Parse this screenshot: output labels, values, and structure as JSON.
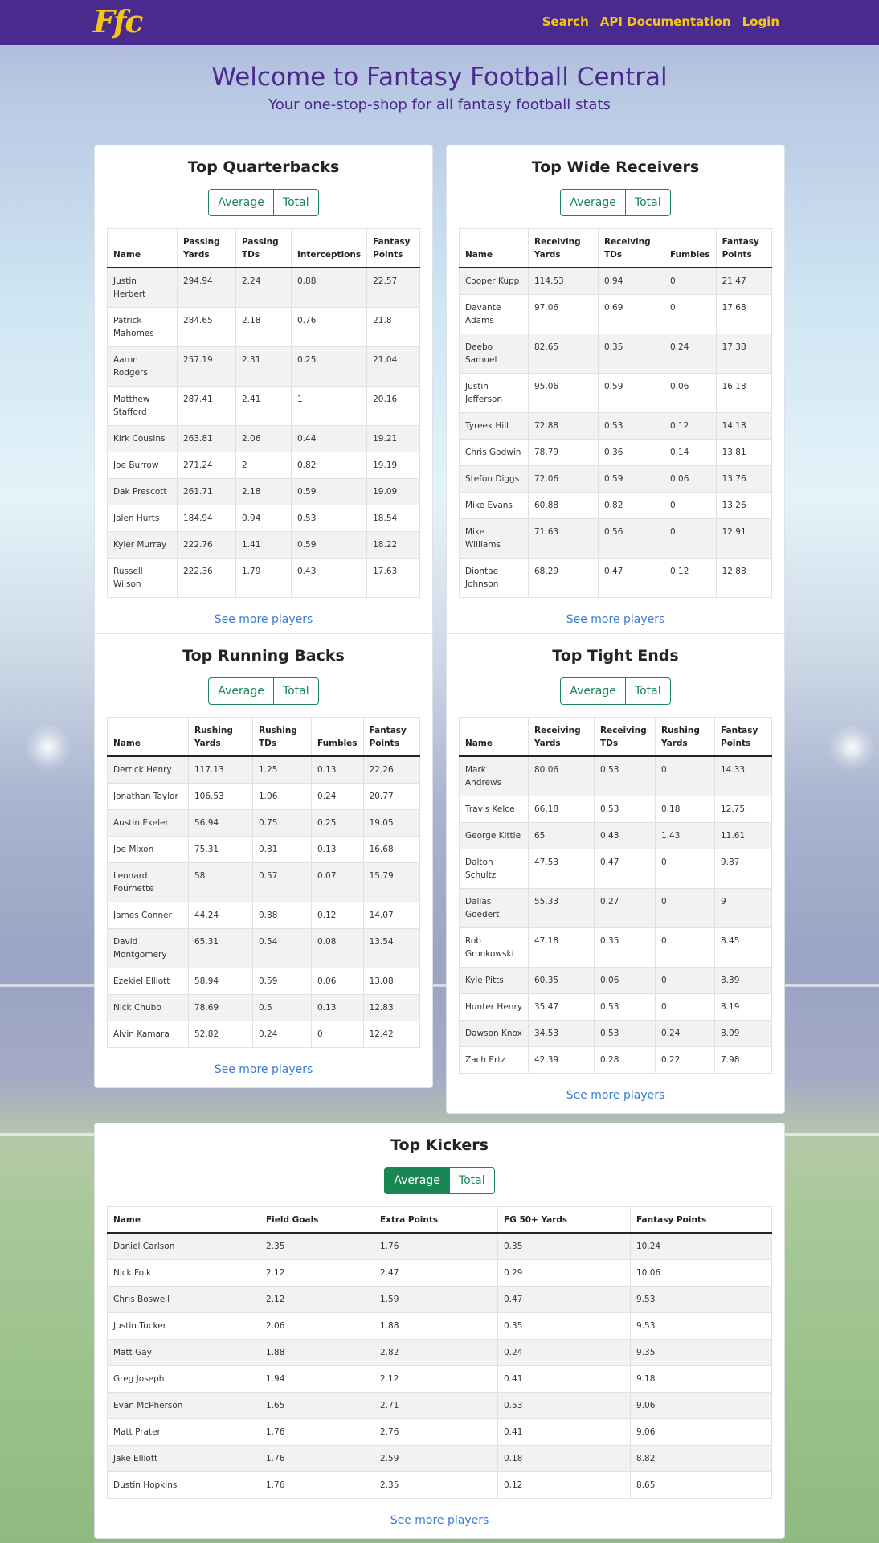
{
  "nav": {
    "logo": "Ffc",
    "links": [
      "Search",
      "API Documentation",
      "Login"
    ]
  },
  "hero": {
    "title": "Welcome to Fantasy Football Central",
    "subtitle": "Your one-stop-shop for all fantasy football stats"
  },
  "toggle": {
    "average": "Average",
    "total": "Total"
  },
  "see_more": "See more players",
  "qb": {
    "title": "Top Quarterbacks",
    "headers": [
      "Name",
      "Passing Yards",
      "Passing TDs",
      "Interceptions",
      "Fantasy Points"
    ],
    "rows": [
      [
        "Justin Herbert",
        "294.94",
        "2.24",
        "0.88",
        "22.57"
      ],
      [
        "Patrick Mahomes",
        "284.65",
        "2.18",
        "0.76",
        "21.8"
      ],
      [
        "Aaron Rodgers",
        "257.19",
        "2.31",
        "0.25",
        "21.04"
      ],
      [
        "Matthew Stafford",
        "287.41",
        "2.41",
        "1",
        "20.16"
      ],
      [
        "Kirk Cousins",
        "263.81",
        "2.06",
        "0.44",
        "19.21"
      ],
      [
        "Joe Burrow",
        "271.24",
        "2",
        "0.82",
        "19.19"
      ],
      [
        "Dak Prescott",
        "261.71",
        "2.18",
        "0.59",
        "19.09"
      ],
      [
        "Jalen Hurts",
        "184.94",
        "0.94",
        "0.53",
        "18.54"
      ],
      [
        "Kyler Murray",
        "222.76",
        "1.41",
        "0.59",
        "18.22"
      ],
      [
        "Russell Wilson",
        "222.36",
        "1.79",
        "0.43",
        "17.63"
      ]
    ]
  },
  "wr": {
    "title": "Top Wide Receivers",
    "headers": [
      "Name",
      "Receiving Yards",
      "Receiving TDs",
      "Fumbles",
      "Fantasy Points"
    ],
    "rows": [
      [
        "Cooper Kupp",
        "114.53",
        "0.94",
        "0",
        "21.47"
      ],
      [
        "Davante Adams",
        "97.06",
        "0.69",
        "0",
        "17.68"
      ],
      [
        "Deebo Samuel",
        "82.65",
        "0.35",
        "0.24",
        "17.38"
      ],
      [
        "Justin Jefferson",
        "95.06",
        "0.59",
        "0.06",
        "16.18"
      ],
      [
        "Tyreek Hill",
        "72.88",
        "0.53",
        "0.12",
        "14.18"
      ],
      [
        "Chris Godwin",
        "78.79",
        "0.36",
        "0.14",
        "13.81"
      ],
      [
        "Stefon Diggs",
        "72.06",
        "0.59",
        "0.06",
        "13.76"
      ],
      [
        "Mike Evans",
        "60.88",
        "0.82",
        "0",
        "13.26"
      ],
      [
        "Mike Williams",
        "71.63",
        "0.56",
        "0",
        "12.91"
      ],
      [
        "Diontae Johnson",
        "68.29",
        "0.47",
        "0.12",
        "12.88"
      ]
    ]
  },
  "rb": {
    "title": "Top Running Backs",
    "headers": [
      "Name",
      "Rushing Yards",
      "Rushing TDs",
      "Fumbles",
      "Fantasy Points"
    ],
    "rows": [
      [
        "Derrick Henry",
        "117.13",
        "1.25",
        "0.13",
        "22.26"
      ],
      [
        "Jonathan Taylor",
        "106.53",
        "1.06",
        "0.24",
        "20.77"
      ],
      [
        "Austin Ekeler",
        "56.94",
        "0.75",
        "0.25",
        "19.05"
      ],
      [
        "Joe Mixon",
        "75.31",
        "0.81",
        "0.13",
        "16.68"
      ],
      [
        "Leonard Fournette",
        "58",
        "0.57",
        "0.07",
        "15.79"
      ],
      [
        "James Conner",
        "44.24",
        "0.88",
        "0.12",
        "14.07"
      ],
      [
        "David Montgomery",
        "65.31",
        "0.54",
        "0.08",
        "13.54"
      ],
      [
        "Ezekiel Elliott",
        "58.94",
        "0.59",
        "0.06",
        "13.08"
      ],
      [
        "Nick Chubb",
        "78.69",
        "0.5",
        "0.13",
        "12.83"
      ],
      [
        "Alvin Kamara",
        "52.82",
        "0.24",
        "0",
        "12.42"
      ]
    ]
  },
  "te": {
    "title": "Top Tight Ends",
    "headers": [
      "Name",
      "Receiving Yards",
      "Receiving TDs",
      "Rushing Yards",
      "Fantasy Points"
    ],
    "rows": [
      [
        "Mark Andrews",
        "80.06",
        "0.53",
        "0",
        "14.33"
      ],
      [
        "Travis Kelce",
        "66.18",
        "0.53",
        "0.18",
        "12.75"
      ],
      [
        "George Kittle",
        "65",
        "0.43",
        "1.43",
        "11.61"
      ],
      [
        "Dalton Schultz",
        "47.53",
        "0.47",
        "0",
        "9.87"
      ],
      [
        "Dallas Goedert",
        "55.33",
        "0.27",
        "0",
        "9"
      ],
      [
        "Rob Gronkowski",
        "47.18",
        "0.35",
        "0",
        "8.45"
      ],
      [
        "Kyle Pitts",
        "60.35",
        "0.06",
        "0",
        "8.39"
      ],
      [
        "Hunter Henry",
        "35.47",
        "0.53",
        "0",
        "8.19"
      ],
      [
        "Dawson Knox",
        "34.53",
        "0.53",
        "0.24",
        "8.09"
      ],
      [
        "Zach Ertz",
        "42.39",
        "0.28",
        "0.22",
        "7.98"
      ]
    ]
  },
  "k": {
    "title": "Top Kickers",
    "headers": [
      "Name",
      "Field Goals",
      "Extra Points",
      "FG 50+ Yards",
      "Fantasy Points"
    ],
    "rows": [
      [
        "Daniel Carlson",
        "2.35",
        "1.76",
        "0.35",
        "10.24"
      ],
      [
        "Nick Folk",
        "2.12",
        "2.47",
        "0.29",
        "10.06"
      ],
      [
        "Chris Boswell",
        "2.12",
        "1.59",
        "0.47",
        "9.53"
      ],
      [
        "Justin Tucker",
        "2.06",
        "1.88",
        "0.35",
        "9.53"
      ],
      [
        "Matt Gay",
        "1.88",
        "2.82",
        "0.24",
        "9.35"
      ],
      [
        "Greg Joseph",
        "1.94",
        "2.12",
        "0.41",
        "9.18"
      ],
      [
        "Evan McPherson",
        "1.65",
        "2.71",
        "0.53",
        "9.06"
      ],
      [
        "Matt Prater",
        "1.76",
        "2.76",
        "0.41",
        "9.06"
      ],
      [
        "Jake Elliott",
        "1.76",
        "2.59",
        "0.18",
        "8.82"
      ],
      [
        "Dustin Hopkins",
        "1.76",
        "2.35",
        "0.12",
        "8.65"
      ]
    ]
  }
}
